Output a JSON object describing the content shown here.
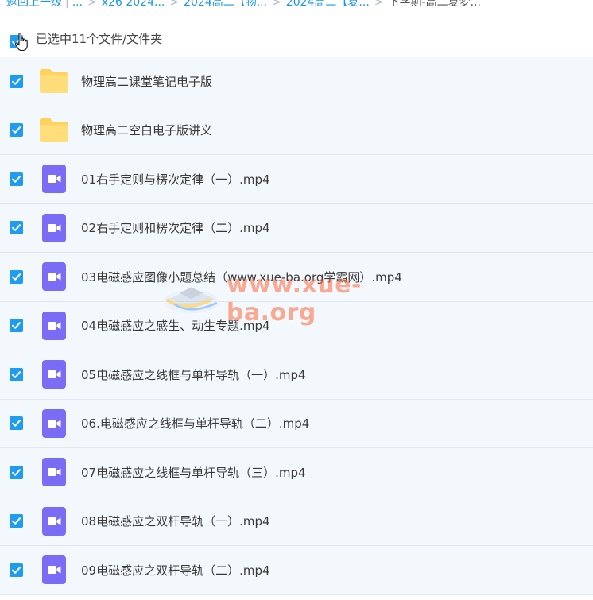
{
  "breadcrumb": {
    "back": "返回上一级",
    "ellipsis": "...",
    "items": [
      "x26 2024...",
      "2024高二【物...",
      "2024高二【夏..."
    ],
    "current": "下学期-高二夏梦..."
  },
  "selection": {
    "label": "已选中11个文件/文件夹",
    "checked": true
  },
  "files": [
    {
      "name": "物理高二课堂笔记电子版",
      "type": "folder"
    },
    {
      "name": "物理高二空白电子版讲义",
      "type": "folder"
    },
    {
      "name": "01右手定则与楞次定律（一）.mp4",
      "type": "video"
    },
    {
      "name": "02右手定则和楞次定律（二）.mp4",
      "type": "video"
    },
    {
      "name": "03电磁感应图像小题总结（www.xue-ba.org学霸网）.mp4",
      "type": "video"
    },
    {
      "name": "04电磁感应之感生、动生专题.mp4",
      "type": "video"
    },
    {
      "name": "05电磁感应之线框与单杆导轨（一）.mp4",
      "type": "video"
    },
    {
      "name": "06.电磁感应之线框与单杆导轨（二）.mp4",
      "type": "video"
    },
    {
      "name": "07电磁感应之线框与单杆导轨（三）.mp4",
      "type": "video"
    },
    {
      "name": "08电磁感应之双杆导轨（一）.mp4",
      "type": "video"
    },
    {
      "name": "09电磁感应之双杆导轨（二）.mp4",
      "type": "video"
    }
  ],
  "watermark": {
    "text": "www.xue-ba.org"
  },
  "colors": {
    "accent": "#1f9cf0",
    "link": "#1c97e6",
    "folder": "#ffd25c",
    "video": "#7b6cf6",
    "row_bg": "#f3f8fd"
  },
  "icons": {
    "folder": "folder-icon",
    "video": "video-file-icon",
    "check": "checkmark-icon"
  }
}
